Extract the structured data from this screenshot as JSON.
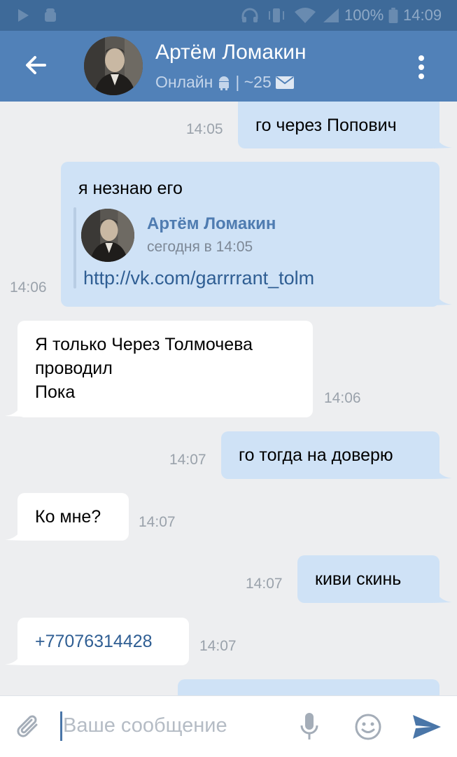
{
  "status_bar": {
    "battery_percent": "100%",
    "clock": "14:09",
    "icons": [
      "play-icon",
      "android-debug-icon",
      "headset-icon",
      "vibrate-icon",
      "wifi-icon",
      "signal-icon",
      "battery-icon"
    ]
  },
  "header": {
    "name": "Артём Ломакин",
    "status": "Онлайн",
    "status_suffix": "| ~25"
  },
  "messages": [
    {
      "direction": "out",
      "text": "го через Попович",
      "time": "14:05"
    },
    {
      "direction": "out",
      "text": "я незнаю его",
      "time": "14:06",
      "repost": {
        "author": "Артём Ломакин",
        "date": "сегодня в 14:05",
        "link": "http://vk.com/garrrrant_tolm"
      }
    },
    {
      "direction": "in",
      "lines": [
        "Я только Через Толмочева",
        "проводил",
        "Пока"
      ],
      "time": "14:06"
    },
    {
      "direction": "out",
      "text": "го тогда на доверю",
      "time": "14:07"
    },
    {
      "direction": "in",
      "text": "Ко мне?",
      "time": "14:07"
    },
    {
      "direction": "out",
      "text": "киви скинь",
      "time": "14:07"
    },
    {
      "direction": "in",
      "text": "+77076314428",
      "time": "14:07",
      "is_phone": true
    }
  ],
  "composer": {
    "placeholder": "Ваше сообщение"
  },
  "colors": {
    "header": "#5181b8",
    "status_bar": "#3e6a99",
    "background": "#edeef0",
    "outgoing_bubble": "#cfe2f6",
    "incoming_bubble": "#ffffff",
    "link": "#2f5e93",
    "accent": "#4a76a8"
  }
}
